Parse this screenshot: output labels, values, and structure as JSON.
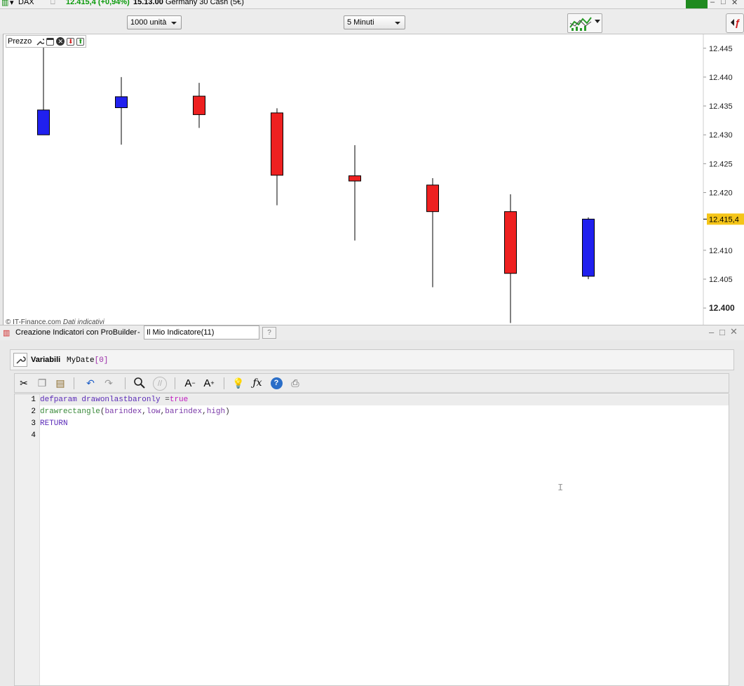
{
  "top_strip": {
    "instrument": "DAX",
    "price_change": "12.415,4 (+0,94%)",
    "time": "15.13.00",
    "description": "Germany 30 Cash (5€)"
  },
  "toolbar": {
    "units_select": "1000 unità",
    "timeframe_select": "5 Minuti"
  },
  "chart_panel": {
    "label": "Prezzo",
    "credit_source": "© IT-Finance.com",
    "credit_note": "Dati indicativi",
    "current_price_label": "12.415,4",
    "colors": {
      "up": "#2020ee",
      "down": "#ee2020",
      "current_price_bg": "#f5c518"
    }
  },
  "chart_data": {
    "type": "candlestick",
    "candles": [
      {
        "open": 12.43,
        "close": 12.4343,
        "high": 12.446,
        "low": 12.43
      },
      {
        "open": 12.4347,
        "close": 12.4366,
        "high": 12.44,
        "low": 12.4283
      },
      {
        "open": 12.4367,
        "close": 12.4335,
        "high": 12.439,
        "low": 12.4312
      },
      {
        "open": 12.4338,
        "close": 12.423,
        "high": 12.4346,
        "low": 12.4178
      },
      {
        "open": 12.4229,
        "close": 12.422,
        "high": 12.4282,
        "low": 12.4117
      },
      {
        "open": 12.4213,
        "close": 12.4167,
        "high": 12.4225,
        "low": 12.4036
      },
      {
        "open": 12.4167,
        "close": 12.406,
        "high": 12.4197,
        "low": 12.3974
      },
      {
        "open": 12.4055,
        "close": 12.4154,
        "high": 12.4157,
        "low": 12.405
      }
    ],
    "y_ticks": [
      "12.445",
      "12.440",
      "12.435",
      "12.430",
      "12.425",
      "12.420",
      "12.410",
      "12.405",
      "12.400"
    ],
    "y_tick_values": [
      12.445,
      12.44,
      12.435,
      12.43,
      12.425,
      12.42,
      12.41,
      12.405,
      12.4
    ],
    "ylim": [
      12.3971,
      12.4474
    ],
    "current_price": 12.4154,
    "grid": false
  },
  "probuilder": {
    "title": "Creazione Indicatori con ProBuilder",
    "separator": "-",
    "indicator_name": "Il Mio Indicatore(11)",
    "variables_label": "Variabili",
    "variable_name": "MyDate",
    "variable_index": "[0]",
    "code_lines": [
      {
        "num": "1",
        "text": "defparam drawonlastbaronly =true"
      },
      {
        "num": "2",
        "text": "drawrectangle(barindex,low,barindex,high)"
      },
      {
        "num": "3",
        "text": "RETURN"
      },
      {
        "num": "4",
        "text": ""
      }
    ]
  },
  "icons": [
    "dax-chart-icon",
    "wrench-icon",
    "cut-icon",
    "copy-icon",
    "paste-icon",
    "undo-icon",
    "redo-icon",
    "search-icon",
    "comment-icon",
    "decrease-font-icon",
    "increase-font-icon",
    "lightbulb-icon",
    "function-icon",
    "help-icon",
    "print-icon"
  ]
}
